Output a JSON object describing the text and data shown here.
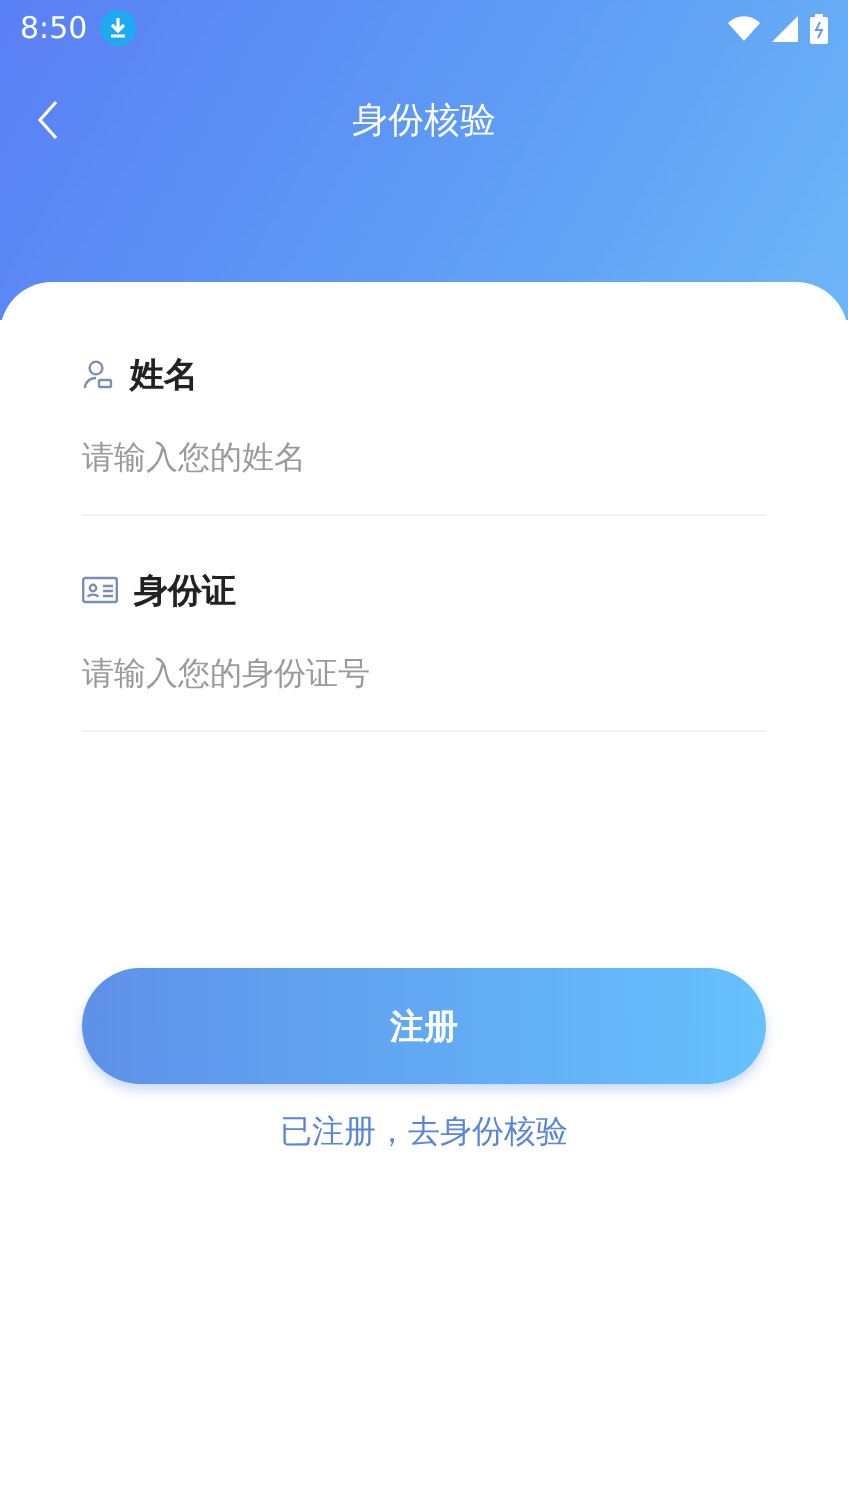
{
  "status_bar": {
    "time": "8:50"
  },
  "nav": {
    "title": "身份核验"
  },
  "fields": [
    {
      "kind": "person",
      "label": "姓名",
      "placeholder": "请输入您的姓名"
    },
    {
      "kind": "id-card",
      "label": "身份证",
      "placeholder": "请输入您的身份证号"
    }
  ],
  "submit_button": "注册",
  "link": "已注册，去身份核验"
}
